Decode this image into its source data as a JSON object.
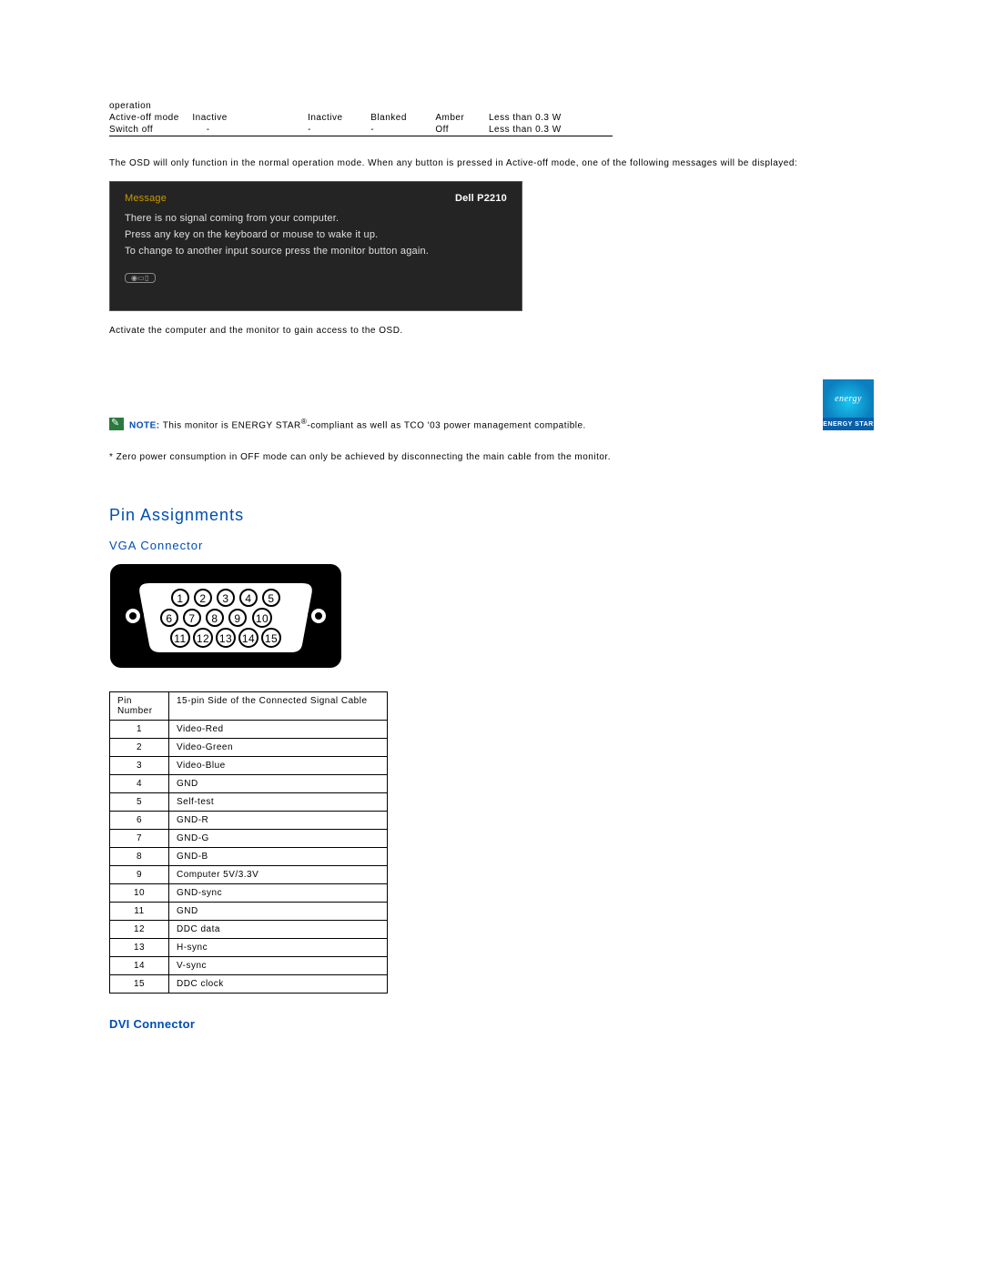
{
  "mode_table": {
    "rows": [
      {
        "c0": "operation",
        "c1": "",
        "c2": "",
        "c3": "",
        "c4": "",
        "c5": ""
      },
      {
        "c0": "Active-off mode",
        "c1": "Inactive",
        "c2": "Inactive",
        "c3": "Blanked",
        "c4": "Amber",
        "c5": "Less than 0.3 W"
      },
      {
        "c0": "Switch off",
        "c1": "-",
        "c2": "-",
        "c3": "-",
        "c4": "Off",
        "c5": "Less than 0.3 W"
      }
    ]
  },
  "osd_intro": "The OSD will only function in the normal operation mode. When any button is pressed in Active-off mode, one of the following messages will be displayed:",
  "osd": {
    "message_label": "Message",
    "model": "Dell P2210",
    "line1": "There is no signal coming from your computer.",
    "line2": "Press any key on the keyboard or mouse to wake it up.",
    "line3": "To change to another input source press the monitor button again.",
    "icon_label": "◉▭▯"
  },
  "activate_text": "Activate the computer and the monitor to gain access to the OSD.",
  "note": {
    "label": "NOTE:",
    "text_before": " This monitor is ENERGY STAR",
    "reg": "®",
    "text_after": "-compliant as well as TCO '03 power management compatible."
  },
  "energy_star": {
    "script": "energy",
    "label": "ENERGY STAR"
  },
  "footnote": "* Zero power consumption in OFF mode can only be achieved by disconnecting the main cable from the monitor.",
  "headings": {
    "pin": "Pin Assignments",
    "vga": "VGA Connector",
    "dvi": "DVI Connector"
  },
  "pin_table": {
    "head_num": "Pin Number",
    "head_sig": "15-pin Side of the Connected Signal Cable",
    "rows": [
      {
        "n": "1",
        "v": "Video-Red"
      },
      {
        "n": "2",
        "v": "Video-Green"
      },
      {
        "n": "3",
        "v": "Video-Blue"
      },
      {
        "n": "4",
        "v": "GND"
      },
      {
        "n": "5",
        "v": "Self-test"
      },
      {
        "n": "6",
        "v": "GND-R"
      },
      {
        "n": "7",
        "v": "GND-G"
      },
      {
        "n": "8",
        "v": "GND-B"
      },
      {
        "n": "9",
        "v": "Computer 5V/3.3V"
      },
      {
        "n": "10",
        "v": "GND-sync"
      },
      {
        "n": "11",
        "v": "GND"
      },
      {
        "n": "12",
        "v": "DDC data"
      },
      {
        "n": "13",
        "v": "H-sync"
      },
      {
        "n": "14",
        "v": "V-sync"
      },
      {
        "n": "15",
        "v": "DDC clock"
      }
    ]
  }
}
